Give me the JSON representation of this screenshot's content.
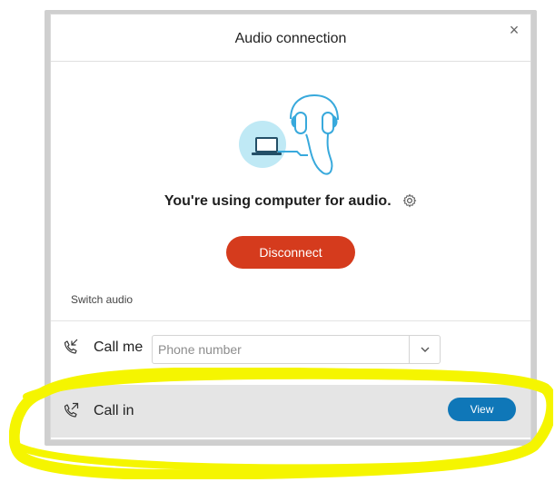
{
  "dialog": {
    "title": "Audio connection",
    "close_label": "×"
  },
  "status": {
    "text": "You're using computer for audio."
  },
  "actions": {
    "disconnect_label": "Disconnect"
  },
  "switch_audio": {
    "label": "Switch audio",
    "call_me": {
      "label": "Call me",
      "placeholder": "Phone number",
      "value": ""
    },
    "call_in": {
      "label": "Call in",
      "button_label": "View"
    }
  },
  "icons": {
    "close": "close-icon",
    "settings": "gear-icon",
    "call_me": "phone-callback-icon",
    "call_in": "phone-outgoing-icon",
    "dropdown": "chevron-down-icon",
    "illustration": "headphones-laptop-illustration"
  },
  "colors": {
    "disconnect": "#d53b1d",
    "view": "#0f77b8",
    "call_in_bg": "#e5e5e5",
    "highlight": "#f5f500"
  }
}
